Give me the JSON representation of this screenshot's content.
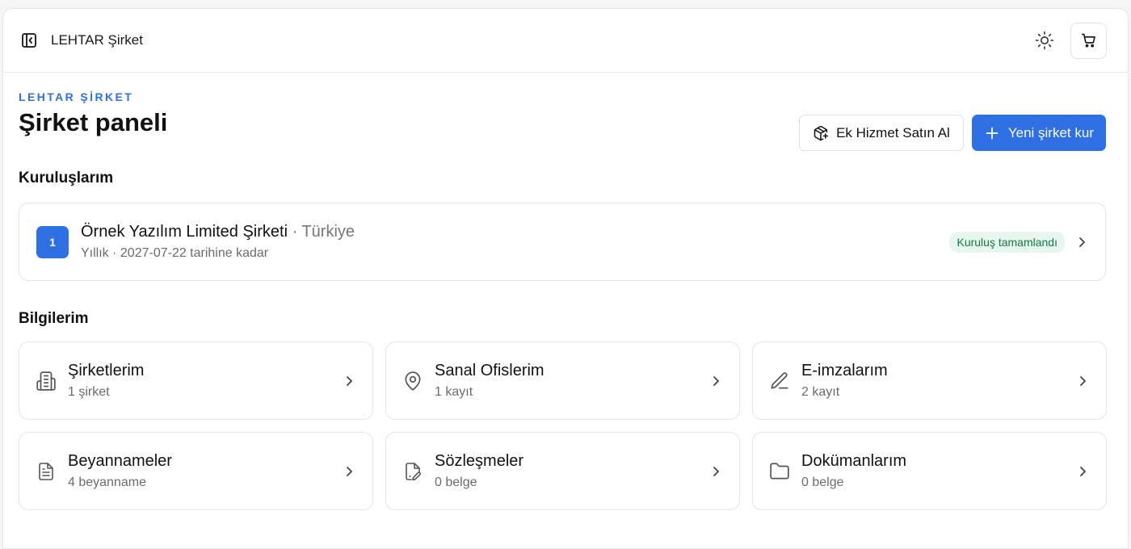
{
  "topbar": {
    "title": "LEHTAR Şirket",
    "icons": {
      "sidebar": "sidebar-toggle-icon",
      "theme": "sun-icon",
      "cart": "cart-icon"
    }
  },
  "header": {
    "eyebrow": "LEHTAR ŞİRKET",
    "title": "Şirket paneli",
    "buy_service_label": "Ek Hizmet Satın Al",
    "new_company_label": "Yeni şirket kur"
  },
  "colors": {
    "accent": "#2f6fe4",
    "success_bg": "#e7f6ee",
    "success_text": "#0f7a45"
  },
  "setups": {
    "title": "Kuruluşlarım",
    "items": [
      {
        "number": "1",
        "name": "Örnek Yazılım Limited Şirketi",
        "separator": "·",
        "country": "Türkiye",
        "period": "Yıllık · 2027-07-22 tarihine kadar",
        "status": "Kuruluş tamamlandı"
      }
    ]
  },
  "info": {
    "title": "Bilgilerim",
    "cards": [
      {
        "icon": "building-icon",
        "title": "Şirketlerim",
        "subtitle": "1 şirket"
      },
      {
        "icon": "map-pin-icon",
        "title": "Sanal Ofislerim",
        "subtitle": "1 kayıt"
      },
      {
        "icon": "pen-icon",
        "title": "E-imzalarım",
        "subtitle": "2 kayıt"
      },
      {
        "icon": "file-text-icon",
        "title": "Beyannameler",
        "subtitle": "4 beyanname"
      },
      {
        "icon": "file-signature-icon",
        "title": "Sözleşmeler",
        "subtitle": "0 belge"
      },
      {
        "icon": "folder-icon",
        "title": "Dokümanlarım",
        "subtitle": "0 belge"
      }
    ]
  }
}
